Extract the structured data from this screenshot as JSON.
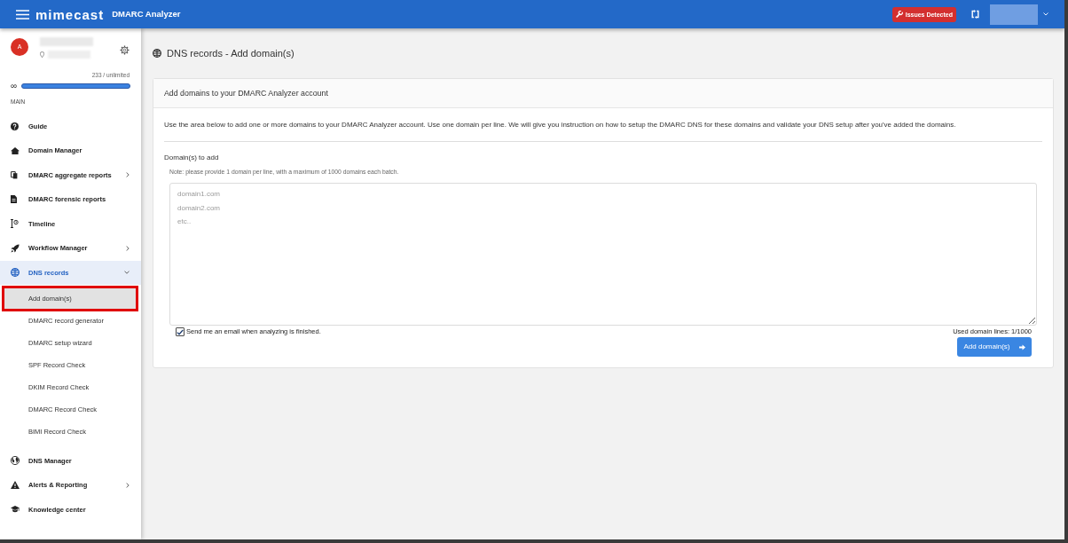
{
  "top_bar": {
    "logo": "mimecast",
    "app_title": "DMARC Analyzer",
    "issues_button": "Issues Detected"
  },
  "sidebar": {
    "avatar_initial": "A",
    "usage": {
      "reading": "233 / unlimited",
      "symbol": "∞",
      "level": 1
    },
    "section_label": "MAIN",
    "items": [
      {
        "label": "Guide",
        "kind": "link",
        "selected": false
      },
      {
        "label": "Domain Manager",
        "kind": "link",
        "selected": false
      },
      {
        "label": "DMARC aggregate reports",
        "kind": "group",
        "selected": false,
        "expanded": false
      },
      {
        "label": "DMARC forensic reports",
        "kind": "link",
        "selected": false
      },
      {
        "label": "Timeline",
        "kind": "link",
        "selected": false
      },
      {
        "label": "Workflow Manager",
        "kind": "group",
        "selected": false,
        "expanded": false
      },
      {
        "label": "DNS records",
        "kind": "group",
        "selected": true,
        "expanded": true,
        "children": [
          {
            "label": "Add domain(s)",
            "selected": true,
            "highlighted": true
          },
          {
            "label": "DMARC record generator",
            "selected": false,
            "highlighted": false
          },
          {
            "label": "DMARC setup wizard",
            "selected": false,
            "highlighted": false
          },
          {
            "label": "SPF Record Check",
            "selected": false,
            "highlighted": false
          },
          {
            "label": "DKIM Record Check",
            "selected": false,
            "highlighted": false
          },
          {
            "label": "DMARC Record Check",
            "selected": false,
            "highlighted": false
          },
          {
            "label": "BIMI Record Check",
            "selected": false,
            "highlighted": false
          }
        ]
      },
      {
        "label": "DNS Manager",
        "kind": "link",
        "selected": false
      },
      {
        "label": "Alerts & Reporting",
        "kind": "group",
        "selected": false,
        "expanded": false
      },
      {
        "label": "Knowledge center",
        "kind": "link",
        "selected": false
      }
    ]
  },
  "page": {
    "title": "DNS records - Add domain(s)"
  },
  "card": {
    "header": "Add domains to your DMARC Analyzer account",
    "intro": "Use the area below to add one or more domains to your DMARC Analyzer account. Use one domain per line. We will give you instruction on how to setup the DMARC DNS for these domains and validate your DNS setup after you've added the domains.",
    "field_label": "Domain(s) to add",
    "note": "Note: please provide 1 domain per line, with a maximum of 1000 domains each batch.",
    "textarea": {
      "placeholder": "domain1.com\ndomain2.com\netc.."
    },
    "email_option": {
      "label": "Send me an email when analyzing is finished.",
      "checked": true
    },
    "line_count": "Used domain lines: 1/1000",
    "submit_button": "Add domain(s)"
  }
}
